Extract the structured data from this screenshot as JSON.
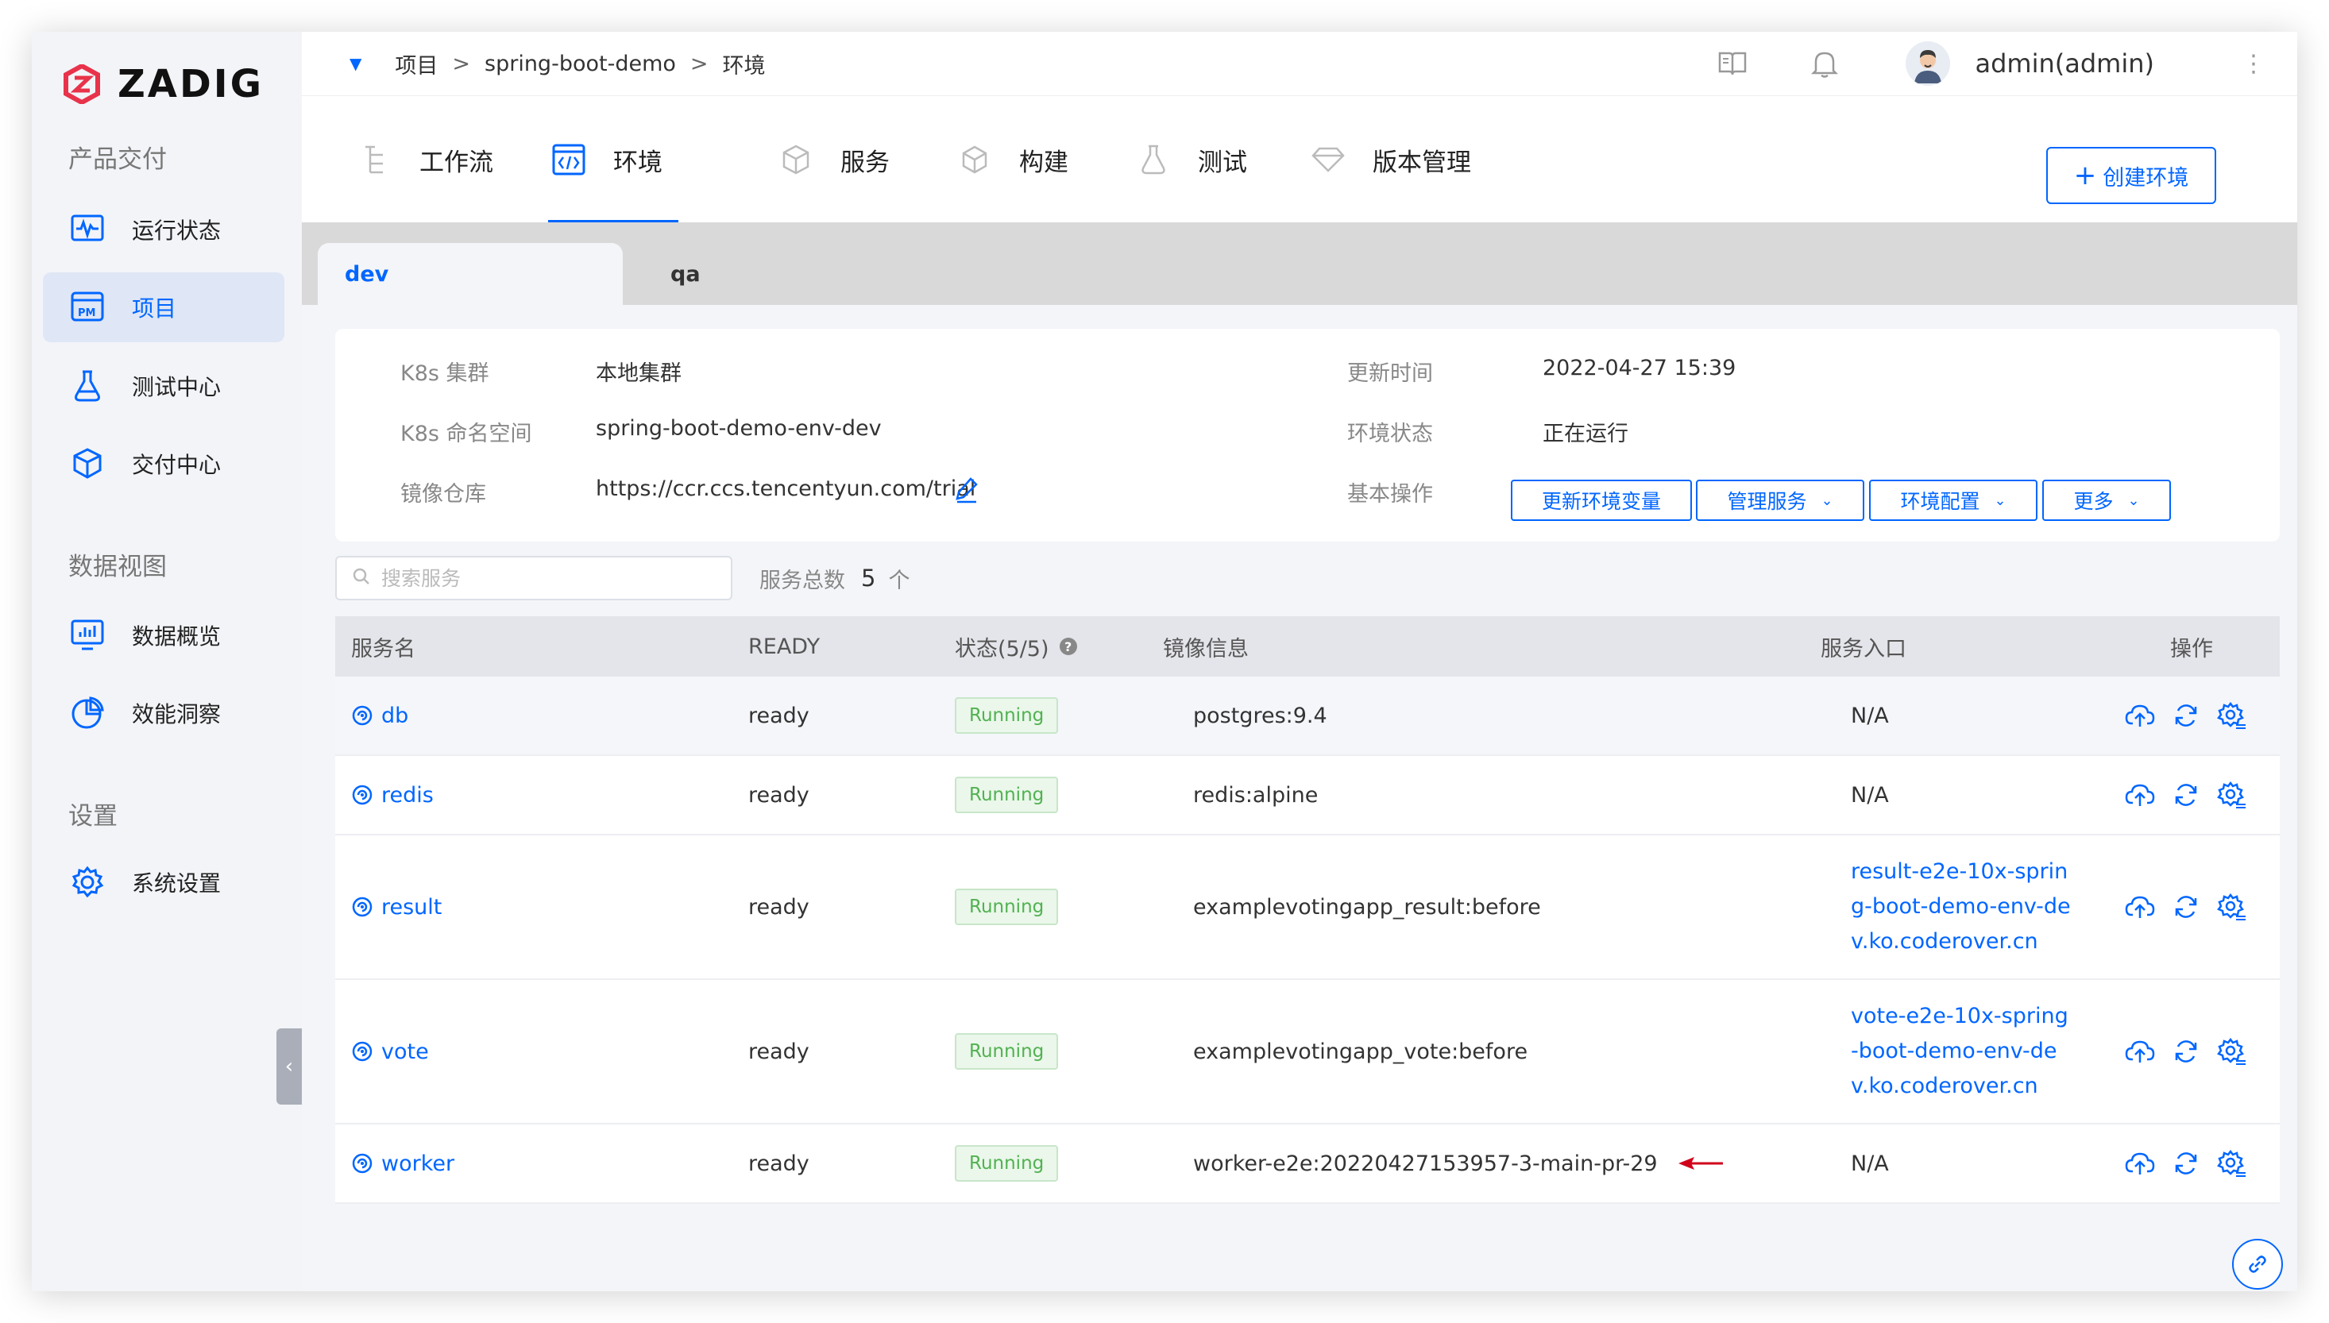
{
  "brand": {
    "name": "ZADIG",
    "color": "#e8334a"
  },
  "accent_color": "#0066ff",
  "sidebar": {
    "sections": [
      {
        "title": "产品交付",
        "items": [
          {
            "label": "运行状态",
            "icon": "monitor-wave-icon"
          },
          {
            "label": "项目",
            "icon": "project-pm-icon",
            "active": true
          },
          {
            "label": "测试中心",
            "icon": "flask-icon"
          },
          {
            "label": "交付中心",
            "icon": "package-icon"
          }
        ]
      },
      {
        "title": "数据视图",
        "items": [
          {
            "label": "数据概览",
            "icon": "chart-monitor-icon"
          },
          {
            "label": "效能洞察",
            "icon": "pie-chart-icon"
          }
        ]
      },
      {
        "title": "设置",
        "items": [
          {
            "label": "系统设置",
            "icon": "gear-icon"
          }
        ]
      }
    ]
  },
  "topbar": {
    "breadcrumb": [
      "项目",
      "spring-boot-demo",
      "环境"
    ],
    "separator": ">",
    "user": "admin(admin)"
  },
  "module_tabs": [
    {
      "label": "工作流",
      "icon": "workflow-icon"
    },
    {
      "label": "环境",
      "icon": "code-window-icon",
      "active": true
    },
    {
      "label": "服务",
      "icon": "cube-cluster-icon"
    },
    {
      "label": "构建",
      "icon": "cube-icon"
    },
    {
      "label": "测试",
      "icon": "flask-icon"
    },
    {
      "label": "版本管理",
      "icon": "diamond-icon"
    }
  ],
  "create_env_label": "创建环境",
  "env_tabs": [
    "dev",
    "qa"
  ],
  "env_info": {
    "k8s_cluster_label": "K8s 集群",
    "k8s_cluster": "本地集群",
    "k8s_namespace_label": "K8s 命名空间",
    "k8s_namespace": "spring-boot-demo-env-dev",
    "registry_label": "镜像仓库",
    "registry": "https://ccr.ccs.tencentyun.com/trial",
    "updated_label": "更新时间",
    "updated": "2022-04-27 15:39",
    "status_label": "环境状态",
    "status": "正在运行",
    "ops_label": "基本操作",
    "ops": [
      "更新环境变量",
      "管理服务",
      "环境配置",
      "更多"
    ]
  },
  "search": {
    "placeholder": "搜索服务"
  },
  "service_count": {
    "prefix": "服务总数",
    "value": "5",
    "unit": "个"
  },
  "table": {
    "headers": [
      "服务名",
      "READY",
      "状态(5/5)",
      "镜像信息",
      "服务入口",
      "操作"
    ],
    "rows": [
      {
        "name": "db",
        "ready": "ready",
        "status": "Running",
        "image": "postgres:9.4",
        "entry": [
          "N/A"
        ]
      },
      {
        "name": "redis",
        "ready": "ready",
        "status": "Running",
        "image": "redis:alpine",
        "entry": [
          "N/A"
        ]
      },
      {
        "name": "result",
        "ready": "ready",
        "status": "Running",
        "image": "examplevotingapp_result:before",
        "entry": [
          "result-e2e-10x-sprin",
          "g-boot-demo-env-de",
          "v.ko.coderover.cn"
        ]
      },
      {
        "name": "vote",
        "ready": "ready",
        "status": "Running",
        "image": "examplevotingapp_vote:before",
        "entry": [
          "vote-e2e-10x-spring",
          "-boot-demo-env-de",
          "v.ko.coderover.cn"
        ]
      },
      {
        "name": "worker",
        "ready": "ready",
        "status": "Running",
        "image": "worker-e2e:20220427153957-3-main-pr-29",
        "entry": [
          "N/A"
        ]
      }
    ]
  },
  "status_color": "#52b152",
  "annotation_arrow_color": "#d0021b"
}
